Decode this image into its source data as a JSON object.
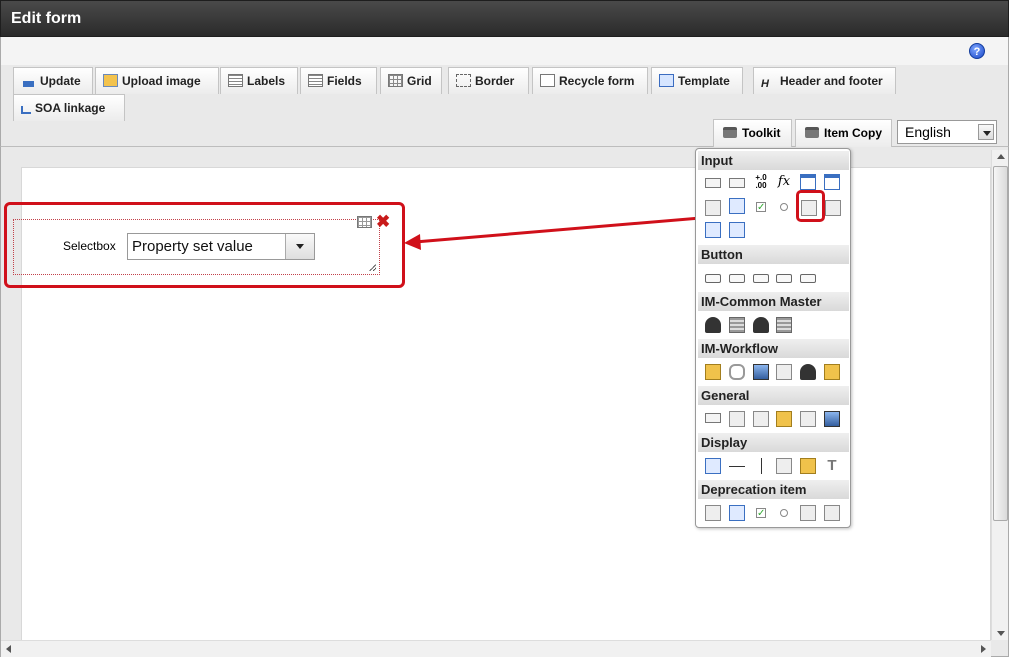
{
  "window": {
    "title": "Edit form"
  },
  "help": {
    "label": "?"
  },
  "toolbar": {
    "tabs": {
      "update": "Update",
      "upload_image": "Upload image",
      "labels": "Labels",
      "fields": "Fields",
      "grid": "Grid",
      "border": "Border",
      "recycle_form": "Recycle form",
      "template": "Template",
      "header_footer": "Header and footer",
      "soa_linkage": "SOA linkage"
    },
    "toolkit": "Toolkit",
    "item_copy": "Item Copy",
    "language": "English"
  },
  "form_item": {
    "label": "Selectbox",
    "value": "Property set value",
    "delete_glyph": "✖"
  },
  "toolbox": {
    "sections": {
      "input": "Input",
      "button": "Button",
      "im_common_master": "IM-Common Master",
      "im_workflow": "IM-Workflow",
      "general": "General",
      "display": "Display",
      "deprecation_item": "Deprecation item"
    },
    "glyphs": {
      "fx": "fx",
      "num": "+.0 .00",
      "text": "T",
      "check": "✓"
    }
  },
  "colors": {
    "highlight": "#d0101a",
    "titlebar": "#333333"
  }
}
